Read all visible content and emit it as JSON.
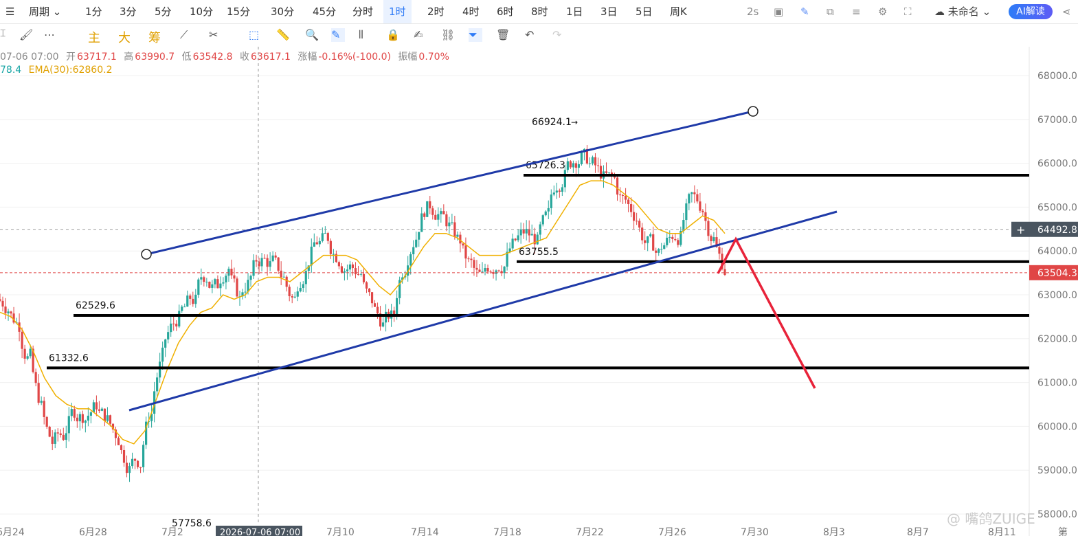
{
  "toolbar": {
    "period_label": "周期",
    "intervals": [
      "1分",
      "3分",
      "5分",
      "10分",
      "15分",
      "30分",
      "45分",
      "分时",
      "1时",
      "2时",
      "4时",
      "6时",
      "8时",
      "1日",
      "3日",
      "5日",
      "周K"
    ],
    "active_interval": "1时",
    "refresh": "2s",
    "layout_name": "未命名",
    "ai_button": "AI解读"
  },
  "drawbar": {
    "main_label": "主",
    "big_label": "大",
    "chou_label": "筹"
  },
  "legend": {
    "datetime": "07-06 07:00",
    "open_label": "开",
    "open": "63717.1",
    "high_label": "高",
    "high": "63990.7",
    "low_label": "低",
    "low": "63542.8",
    "close_label": "收",
    "close": "63617.1",
    "change_label": "涨幅",
    "change": "-0.16%(-100.0)",
    "amp_label": "振幅",
    "amp": "0.70%",
    "ma_partial": "78.4",
    "ema_label": "EMA(30):62860.2"
  },
  "chart_data": {
    "type": "candlestick",
    "title": "",
    "ylim": [
      57700,
      68400
    ],
    "y_ticks": [
      "68000.0",
      "67000.0",
      "66000.0",
      "65000.0",
      "64000.0",
      "63000.0",
      "62000.0",
      "61000.0",
      "60000.0",
      "59000.0",
      "58000.0"
    ],
    "x_ticks": [
      "6月24",
      "6月28",
      "7月2",
      "7月6",
      "7月10",
      "7月14",
      "7月18",
      "7月22",
      "7月26",
      "7月30",
      "8月3",
      "8月7",
      "8月11",
      "第"
    ],
    "crosshair_label": "2026-07-06 07:00",
    "crosshair_price": "64492.8",
    "last_price": "63504.3",
    "horizontal_levels": [
      {
        "price": 65726.3,
        "label": "65726.3"
      },
      {
        "price": 63755.5,
        "label": "63755.5"
      },
      {
        "price": 62529.6,
        "label": "62529.6"
      },
      {
        "price": 61332.6,
        "label": "61332.6"
      }
    ],
    "annotations": [
      {
        "text": "66924.1",
        "price": 66924.1
      },
      {
        "text": "57758.6",
        "price": 57758.6
      }
    ],
    "close_series": [
      62800,
      62300,
      61500,
      60200,
      59400,
      59800,
      60400,
      60300,
      60500,
      60100,
      59700,
      59100,
      59300,
      60600,
      61800,
      62400,
      62700,
      62900,
      63600,
      63100,
      63900,
      62700,
      63500,
      63900,
      63700,
      63300,
      62800,
      63900,
      64300,
      64200,
      63900,
      63700,
      63500,
      62600,
      62300,
      62500,
      64000,
      64700,
      65200,
      65000,
      64500,
      64100,
      63500,
      63200,
      63800,
      63900,
      64200,
      64400,
      64200,
      64700,
      65900,
      66100,
      66300,
      65900,
      65600,
      65500,
      65000,
      64800,
      64100,
      63900,
      64300,
      64500,
      65200,
      65000,
      64300,
      63500
    ],
    "ema_series": [
      62600,
      62500,
      62200,
      61700,
      61100,
      60700,
      60500,
      60400,
      60400,
      60200,
      60000,
      59700,
      59600,
      59900,
      60600,
      61300,
      61900,
      62300,
      62600,
      62700,
      63000,
      62900,
      63000,
      63300,
      63400,
      63400,
      63300,
      63500,
      63700,
      63900,
      63900,
      63900,
      63800,
      63500,
      63200,
      63000,
      63300,
      63700,
      64100,
      64400,
      64400,
      64300,
      64100,
      63900,
      63900,
      63900,
      64000,
      64100,
      64200,
      64300,
      64700,
      65100,
      65500,
      65600,
      65600,
      65500,
      65300,
      65100,
      64800,
      64500,
      64400,
      64400,
      64600,
      64800,
      64700,
      64400
    ]
  },
  "watermark": "@ 嘴鸽ZUIGE"
}
